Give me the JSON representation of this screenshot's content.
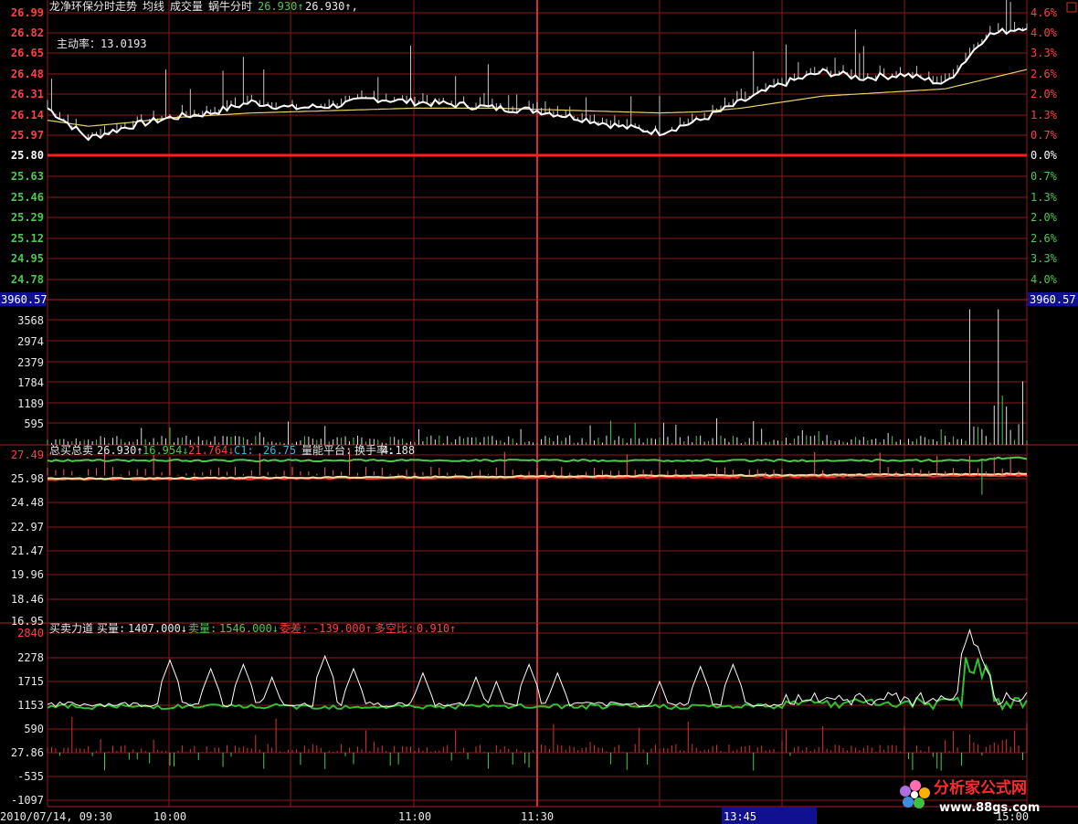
{
  "colors": {
    "bg": "#000000",
    "grid": "#8b1a1a",
    "up": "#ff4040",
    "down": "#4ec94e",
    "white": "#ffffff",
    "yellow": "#e8d26a",
    "cyan": "#38b8d8",
    "label_white": "#e8e8e8"
  },
  "header": {
    "title": "龙净环保分时走势",
    "avg_label": "均线",
    "vol_label": "成交量",
    "indicator_label": "蜗牛分时",
    "price_value": "26.930↑",
    "price_value2": "26.930↑,"
  },
  "active_rate": {
    "label": "主动率：",
    "value": "13.0193"
  },
  "price_axis": {
    "left": [
      "26.99",
      "26.82",
      "26.65",
      "26.48",
      "26.31",
      "26.14",
      "25.97",
      "25.80",
      "25.63",
      "25.46",
      "25.29",
      "25.12",
      "24.95",
      "24.78"
    ],
    "right": [
      "4.6%",
      "4.0%",
      "3.3%",
      "2.6%",
      "2.0%",
      "1.3%",
      "0.7%",
      "0.0%",
      "0.7%",
      "1.3%",
      "2.0%",
      "2.6%",
      "3.3%",
      "4.0%"
    ],
    "close": 25.8
  },
  "volume_axis": {
    "max_label": "3960.57",
    "ticks": [
      "3568",
      "2974",
      "2379",
      "1784",
      "1189",
      "595"
    ]
  },
  "panel2": {
    "title": "总买总卖",
    "v1": "26.930↑",
    "v2": "16.954↓",
    "v3": "21.764↓",
    "v4_label": "C1:",
    "v4": "26.75",
    "v5": "量能平台:",
    "v6_label": "换手率:",
    "v6": "4.188",
    "ticks": [
      "27.49",
      "25.98",
      "24.48",
      "22.97",
      "21.47",
      "19.96",
      "18.46",
      "16.95"
    ]
  },
  "panel3": {
    "title": "买卖力道",
    "buy_label": "买量:",
    "buy_value": "1407.000↓",
    "sell_label": "卖量:",
    "sell_value": "1546.000↓",
    "diff_label": "委差:",
    "diff_value": "-139.000↑",
    "ratio_label": "多空比:",
    "ratio_value": "0.910↑",
    "ticks": [
      "2840",
      "2278",
      "1715",
      "1153",
      "590",
      "27.86",
      "-535",
      "-1097"
    ]
  },
  "time_axis": {
    "labels": [
      "2010/07/14, 09:30",
      "10:00",
      "11:00",
      "11:30",
      "13:45",
      "15:00"
    ],
    "highlight": "13:45"
  },
  "watermark": {
    "cn": "分析家公式网",
    "url": "www.88gs.com"
  },
  "chart_data": [
    {
      "type": "line",
      "name": "price_timeshare",
      "ylim": [
        24.78,
        26.99
      ],
      "x_anchor": [
        0,
        10,
        20,
        30,
        40,
        50,
        60,
        70,
        80,
        90,
        100,
        110,
        120,
        130,
        140,
        150,
        160,
        170,
        180,
        190,
        200,
        210,
        220,
        230,
        240
      ],
      "price": [
        26.2,
        25.95,
        26.05,
        26.12,
        26.16,
        26.25,
        26.2,
        26.22,
        26.28,
        26.25,
        26.23,
        26.2,
        26.18,
        26.12,
        26.05,
        26.0,
        26.1,
        26.25,
        26.4,
        26.5,
        26.45,
        26.48,
        26.4,
        26.8,
        26.88
      ],
      "avg": [
        26.1,
        26.05,
        26.08,
        26.12,
        26.14,
        26.16,
        26.17,
        26.18,
        26.19,
        26.2,
        26.2,
        26.2,
        26.19,
        26.18,
        26.17,
        26.16,
        26.17,
        26.2,
        26.25,
        26.3,
        26.32,
        26.34,
        26.36,
        26.44,
        26.52
      ]
    },
    {
      "type": "bar",
      "name": "volume",
      "ylim": [
        0,
        3960.57
      ]
    },
    {
      "type": "line",
      "name": "total_buy_sell",
      "ylim": [
        16.95,
        27.49
      ]
    },
    {
      "type": "line",
      "name": "buy_sell_force",
      "ylim": [
        -1097,
        2840
      ]
    }
  ]
}
